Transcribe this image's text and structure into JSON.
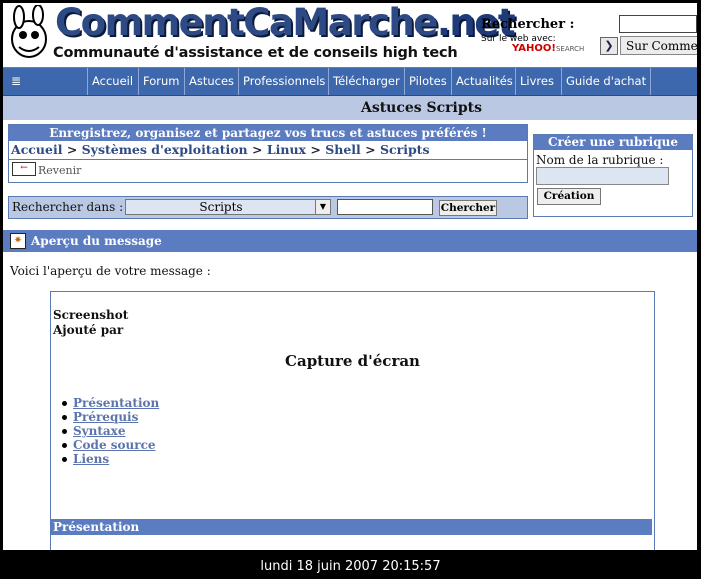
{
  "site": {
    "title_main": "CommentCaMarche",
    "title_tld": ".net",
    "subtitle": "Communauté d'assistance et de conseils high tech",
    "colors": {
      "brand_blue": "#2d4a84",
      "nav_blue": "#3e68ad",
      "header_blue": "#5b7cc0",
      "light_blue": "#bac8e4"
    }
  },
  "web_search": {
    "label": "Rechercher :",
    "provider_text": "Sur le web avec:",
    "provider_logo": "YAHOO!",
    "provider_logo_suffix": "SEARCH",
    "go_icon": "arrow-right-icon",
    "button_label": "Sur Commen"
  },
  "nav": {
    "items": [
      "Accueil",
      "Forum",
      "Astuces",
      "Professionnels",
      "Télécharger",
      "Pilotes",
      "Actualités",
      "Livres",
      "Guide d'achat"
    ]
  },
  "page_title": "Astuces Scripts",
  "share_box": {
    "title": "Enregistrez, organisez et partagez vos trucs et astuces préférés !",
    "breadcrumb": [
      "Accueil",
      "Systèmes d'exploitation",
      "Linux",
      "Shell",
      "Scripts"
    ],
    "separator": " > ",
    "back_label": "Revenir"
  },
  "search_in": {
    "label": "Rechercher dans :",
    "selected": "Scripts",
    "button_label": "Chercher"
  },
  "rubrique": {
    "title": "Créer une rubrique",
    "field_label": "Nom de la rubrique :",
    "button_label": "Création"
  },
  "preview": {
    "title": "Aperçu du message",
    "intro": "Voici l'aperçu de votre message :"
  },
  "message": {
    "line1": "Screenshot",
    "line2": "Ajouté par",
    "heading": "Capture d'écran",
    "toc": [
      "Présentation",
      "Prérequis",
      "Syntaxe",
      "Code source",
      "Liens"
    ],
    "section_title": "Présentation"
  },
  "taskbar": {
    "clock": "lundi 18 juin 2007 20:15:57"
  }
}
